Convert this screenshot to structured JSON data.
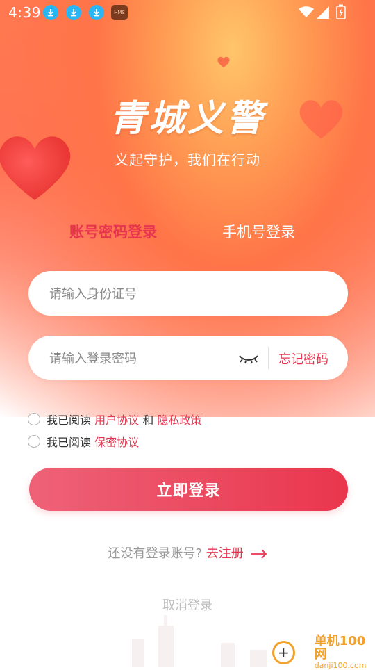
{
  "status_bar": {
    "time": "4:39",
    "hms_label": "HMS"
  },
  "brand": {
    "title": "青城义警",
    "slogan": "义起守护，我们在行动"
  },
  "tabs": {
    "account": "账号密码登录",
    "phone": "手机号登录"
  },
  "form": {
    "id_placeholder": "请输入身份证号",
    "password_placeholder": "请输入登录密码",
    "forgot_label": "忘记密码"
  },
  "agreements": {
    "row1": {
      "prefix": "我已阅读",
      "link1": "用户协议",
      "conj": "和",
      "link2": "隐私政策"
    },
    "row2": {
      "prefix": "我已阅读",
      "link1": "保密协议"
    }
  },
  "login_button": "立即登录",
  "register": {
    "prompt": "还没有登录账号?",
    "link": "去注册"
  },
  "cancel_label": "取消登录",
  "watermark": {
    "cn": "单机100网",
    "en": "danji100.com"
  },
  "colors": {
    "accent": "#e8354f",
    "header_orange": "#ff7448",
    "button_start": "#ee6278",
    "button_end": "#e9364d"
  }
}
